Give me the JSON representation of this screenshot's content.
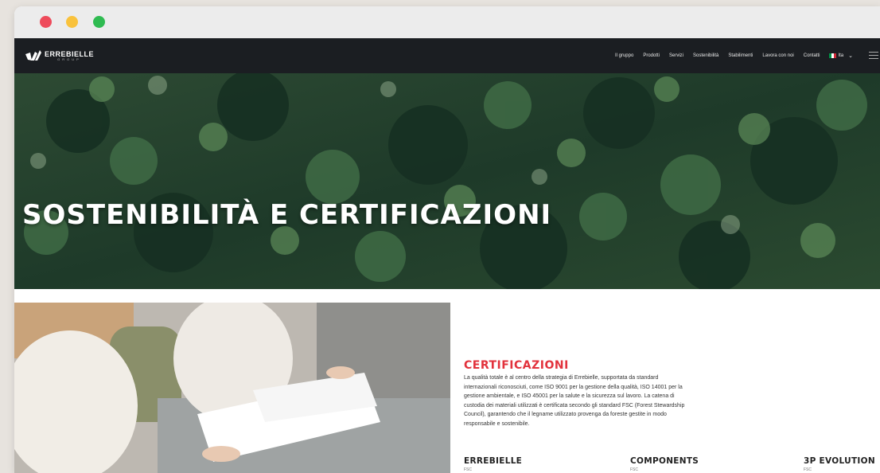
{
  "nav": {
    "logo_name": "ERREBIELLE",
    "logo_sub": "GROUP",
    "items": [
      "Il gruppo",
      "Prodotti",
      "Servizi",
      "Sostenibilità",
      "Stabilimenti",
      "Lavora con noi",
      "Contatti"
    ],
    "language": "Ita"
  },
  "hero": {
    "title": "SOSTENIBILITÀ E CERTIFICAZIONI"
  },
  "certifications": {
    "title": "CERTIFICAZIONI",
    "text": "La qualità totale è al centro della strategia di Errebielle, supportata da standard internazionali riconosciuti, come ISO 9001 per la gestione della qualità, ISO 14001 per la gestione ambientale, e ISO 45001 per la salute e la sicurezza sul lavoro. La catena di custodia dei materiali utilizzati è certificata secondo gli standard FSC (Forest Stewardship Council), garantendo che il legname utilizzato provenga da foreste gestite in modo responsabile e sostenibile."
  },
  "companies": [
    {
      "name": "ERREBIELLE",
      "cert": "FSC"
    },
    {
      "name": "COMPONENTS",
      "cert": "FSC"
    },
    {
      "name": "3P EVOLUTION",
      "cert": "FSC"
    }
  ],
  "colors": {
    "nav_bg": "#1b1e22",
    "accent_red": "#e2323c",
    "window_red": "#ee4b5b",
    "window_yellow": "#f9c23c",
    "window_green": "#2fbb51"
  },
  "icons": [
    "close-dot-icon",
    "minimize-dot-icon",
    "maximize-dot-icon",
    "errebielle-logo-icon",
    "italy-flag-icon",
    "chevron-down-icon",
    "hamburger-menu-icon"
  ]
}
